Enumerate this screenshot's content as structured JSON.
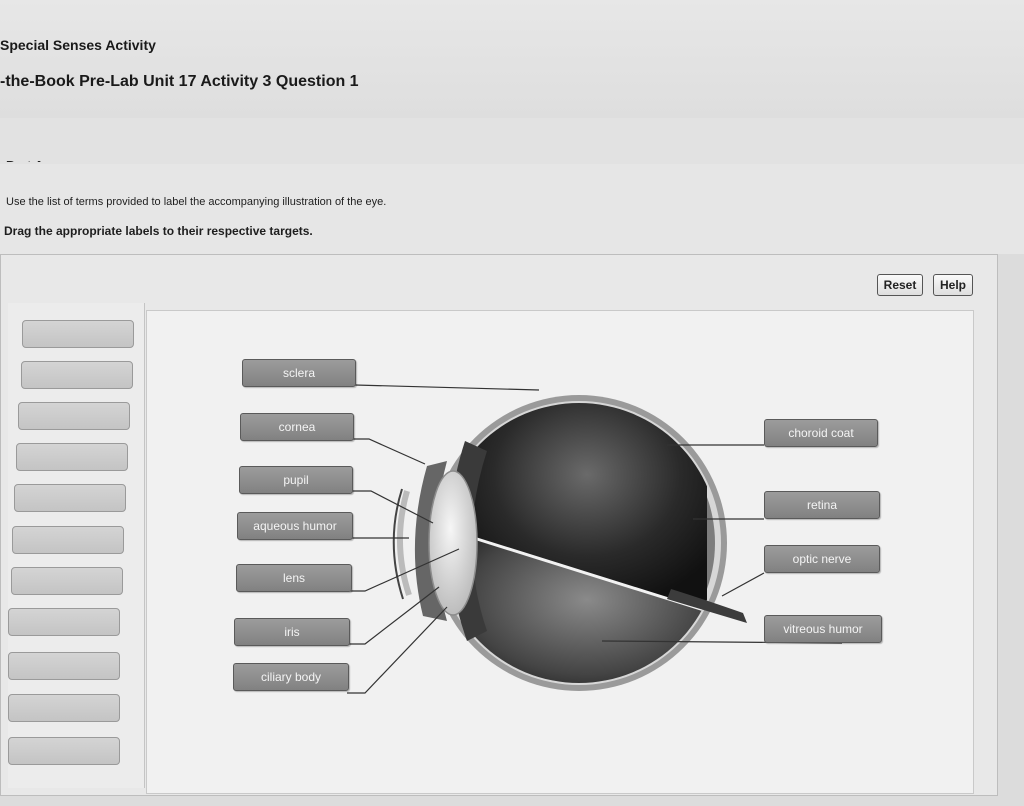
{
  "header": {
    "course_title": "Special Senses Activity",
    "question_title": "-the-Book Pre-Lab Unit 17 Activity 3 Question 1",
    "part_label": "Part A"
  },
  "instructions": {
    "line1": "Use the list of terms provided to label the accompanying illustration of the eye.",
    "line2": "Drag the appropriate labels to their respective targets."
  },
  "toolbar": {
    "reset_label": "Reset",
    "help_label": "Help"
  },
  "labels": {
    "sclera": "sclera",
    "cornea": "cornea",
    "pupil": "pupil",
    "aqueous_humor": "aqueous humor",
    "lens": "lens",
    "iris": "iris",
    "ciliary_body": "ciliary body",
    "choroid_coat": "choroid coat",
    "retina": "retina",
    "optic_nerve": "optic nerve",
    "vitreous_humor": "vitreous humor"
  },
  "colors": {
    "chip_fill": "#8f8f8f",
    "slot_fill": "#cacaca",
    "background": "#dcdcdc"
  }
}
